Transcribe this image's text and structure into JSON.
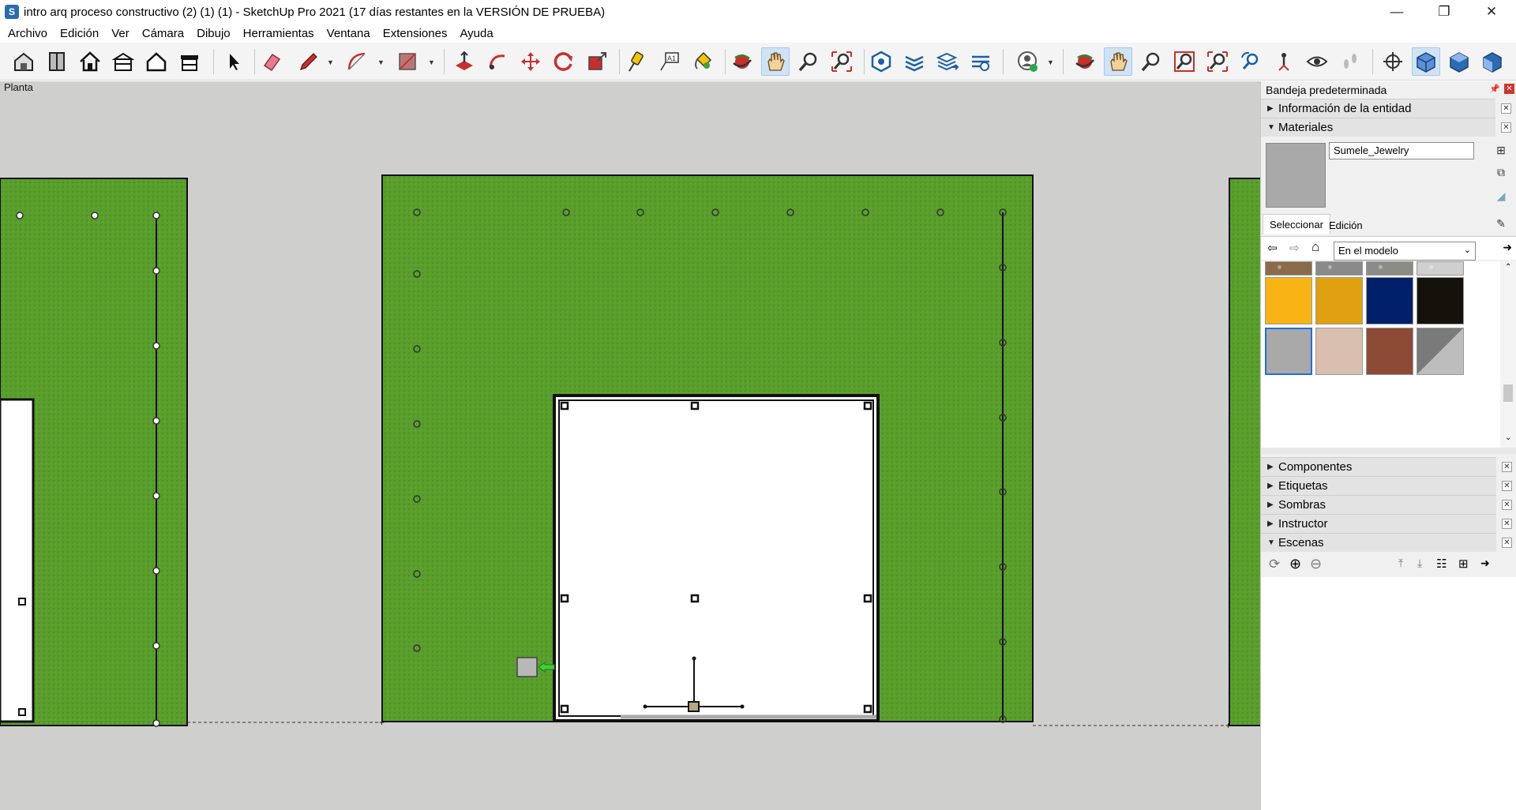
{
  "window": {
    "title": "intro arq proceso constructivo (2) (1) (1) - SketchUp Pro 2021 (17 días restantes en la VERSIÓN DE PRUEBA)",
    "app_icon_letter": "S",
    "minimize": "—",
    "restore": "❐",
    "close": "✕"
  },
  "menu": [
    "Archivo",
    "Edición",
    "Ver",
    "Cámara",
    "Dibujo",
    "Herramientas",
    "Ventana",
    "Extensiones",
    "Ayuda"
  ],
  "viewport": {
    "scene_label": "Planta",
    "background": "#cfcfcd",
    "wall_color": "#5a9e2c",
    "opening_fill": "#ffffff"
  },
  "tray": {
    "title": "Bandeja predeterminada",
    "panels_top": [
      {
        "label": "Información de la entidad",
        "expanded": false
      },
      {
        "label": "Materiales",
        "expanded": true
      }
    ],
    "materials": {
      "current_name": "Sumele_Jewelry",
      "current_color": "#a9a9a9",
      "tab_select": "Seleccionar",
      "tab_edit": "Edición",
      "library": "En el modelo",
      "swatches": [
        {
          "color": "#8b6b4a",
          "name": "gravel"
        },
        {
          "color": "#8a8a8a",
          "name": "gravel-grey"
        },
        {
          "color": "#8c8c86",
          "name": "gravel-mixed"
        },
        {
          "color": "#cfcfcf",
          "name": "speckle-white"
        },
        {
          "color": "#f7b414",
          "name": "yellow"
        },
        {
          "color": "#e0a00f",
          "name": "gold"
        },
        {
          "color": "#00206a",
          "name": "navy"
        },
        {
          "color": "#15120c",
          "name": "black"
        },
        {
          "color": "#a9a9a9",
          "name": "grey-selected"
        },
        {
          "color": "#d9bfb0",
          "name": "rose"
        },
        {
          "color": "#8d4a35",
          "name": "brown"
        },
        {
          "color": "#9a9a9a",
          "name": "two-tone-grey"
        }
      ]
    },
    "panels_bottom": [
      {
        "label": "Componentes",
        "expanded": false
      },
      {
        "label": "Etiquetas",
        "expanded": false
      },
      {
        "label": "Sombras",
        "expanded": false
      },
      {
        "label": "Instructor",
        "expanded": false
      },
      {
        "label": "Escenas",
        "expanded": true
      }
    ]
  },
  "toolbar_icons": [
    "warehouse-icon",
    "components-icon",
    "home-icon",
    "building-icon",
    "house-outline-icon",
    "shop-icon",
    "select-arrow-icon",
    "eraser-icon",
    "pencil-icon",
    "arc-icon",
    "rectangle-icon",
    "push-pull-icon",
    "follow-me-icon",
    "move-icon",
    "rotate-icon",
    "scale-icon",
    "tape-measure-icon",
    "text-icon",
    "paint-bucket-icon",
    "orbit-icon",
    "pan-icon",
    "zoom-icon",
    "zoom-extents-icon",
    "solid-tools-icon",
    "section-plane-icon",
    "layers-icon",
    "sandbox-icon",
    "account-icon",
    "orbit2-icon",
    "pan2-icon",
    "zoom2-icon",
    "zoom-window-icon",
    "zoom-extents2-icon",
    "previous-view-icon",
    "position-camera-icon",
    "look-around-icon",
    "walk-icon",
    "axes-icon",
    "iso-view-icon",
    "top-view-icon",
    "front-view-icon"
  ]
}
